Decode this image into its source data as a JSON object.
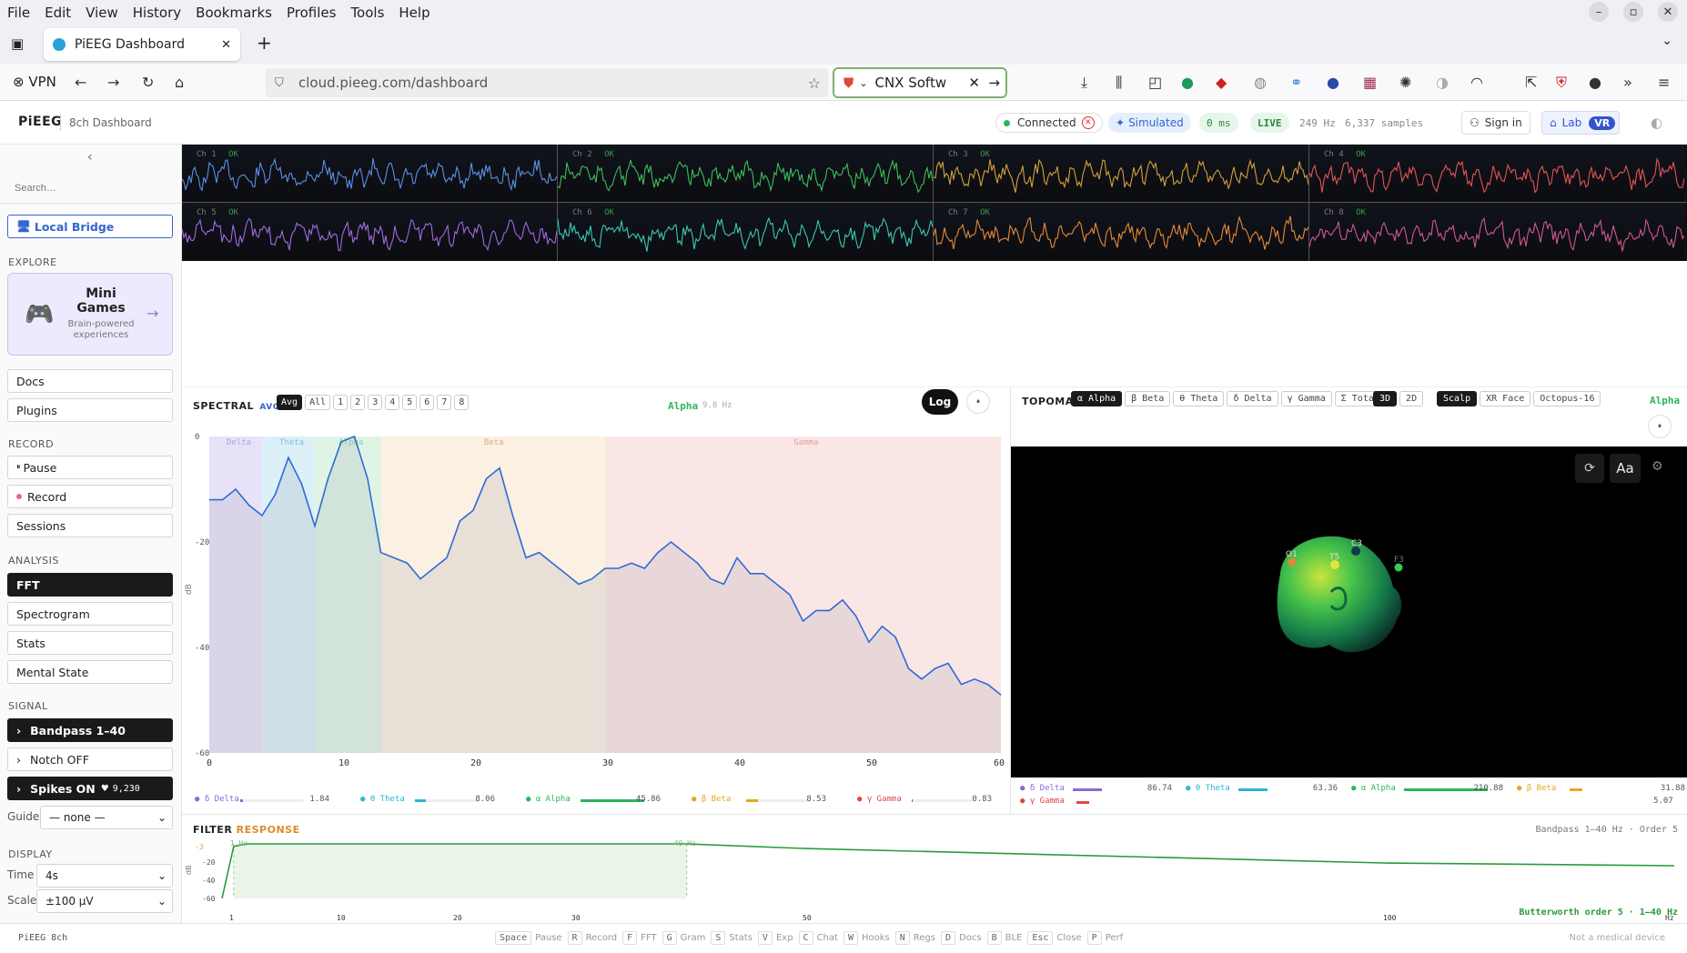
{
  "browser": {
    "menu": [
      "File",
      "Edit",
      "View",
      "History",
      "Bookmarks",
      "Profiles",
      "Tools",
      "Help"
    ],
    "tab_title": "PiEEG Dashboard",
    "vpn_label": "VPN",
    "url": "cloud.pieeg.com/dashboard",
    "search_text": "CNX Softw"
  },
  "app": {
    "brand": "PiEEG",
    "subtitle": "8ch Dashboard",
    "status": {
      "connected": "Connected",
      "simulated": "Simulated",
      "latency": "0 ms",
      "live": "LIVE",
      "rate": "249 Hz",
      "samples": "6,337 samples"
    },
    "signin": "Sign in",
    "lab": "Lab",
    "vr": "VR"
  },
  "sidebar": {
    "search_placeholder": "Search…",
    "local_bridge": "Local Bridge",
    "explore_label": "EXPLORE",
    "minigames_title": "Mini Games",
    "minigames_sub": "Brain-powered experiences",
    "docs": "Docs",
    "plugins": "Plugins",
    "record_label": "RECORD",
    "pause": "Pause",
    "record": "Record",
    "sessions": "Sessions",
    "analysis_label": "ANALYSIS",
    "fft": "FFT",
    "spectrogram": "Spectrogram",
    "stats": "Stats",
    "mental": "Mental State",
    "signal_label": "SIGNAL",
    "bandpass": "Bandpass 1–40",
    "notch": "Notch OFF",
    "spikes": "Spikes ON",
    "spikes_count": "9,230",
    "guide_label": "Guide",
    "guide_value": "— none —",
    "display_label": "DISPLAY",
    "time_label": "Time",
    "time_value": "4s",
    "scale_label": "Scale",
    "scale_value": "±100 µV"
  },
  "channels": [
    {
      "name": "Ch 1",
      "status": "OK",
      "color": "#5b8fe6"
    },
    {
      "name": "Ch 2",
      "status": "OK",
      "color": "#3dbd5c"
    },
    {
      "name": "Ch 3",
      "status": "OK",
      "color": "#d4a03a"
    },
    {
      "name": "Ch 4",
      "status": "OK",
      "color": "#e25555"
    },
    {
      "name": "Ch 5",
      "status": "OK",
      "color": "#a06ae0"
    },
    {
      "name": "Ch 6",
      "status": "OK",
      "color": "#3cc6b4"
    },
    {
      "name": "Ch 7",
      "status": "OK",
      "color": "#e58a3a"
    },
    {
      "name": "Ch 8",
      "status": "OK",
      "color": "#d05a8a"
    }
  ],
  "spectral": {
    "title": "SPECTRAL",
    "mode": "AVG",
    "chips": [
      "Avg",
      "All",
      "1",
      "2",
      "3",
      "4",
      "5",
      "6",
      "7",
      "8"
    ],
    "peak_band": "Alpha",
    "peak_freq": "9.8 Hz",
    "log": "Log",
    "ylabel": "dB",
    "xunit": "Hz",
    "band_labels": [
      "Delta",
      "Theta",
      "Alpha",
      "Beta",
      "Gamma"
    ],
    "legend": [
      {
        "label": "δ Delta",
        "value": "1.84",
        "color": "#8a6ad8"
      },
      {
        "label": "θ Theta",
        "value": "8.06",
        "color": "#2bb5d8"
      },
      {
        "label": "α Alpha",
        "value": "45.86",
        "color": "#2cb55c"
      },
      {
        "label": "β Beta",
        "value": "8.53",
        "color": "#e8a52a"
      },
      {
        "label": "γ Gamma",
        "value": "0.83",
        "color": "#e04848"
      }
    ]
  },
  "chart_data": [
    {
      "type": "line",
      "title": "",
      "xlabel": "Hz",
      "ylabel": "dB",
      "xlim": [
        0,
        60
      ],
      "ylim": [
        -60,
        0
      ],
      "xticks": [
        0,
        10,
        20,
        30,
        40,
        50,
        60
      ],
      "yticks": [
        0,
        -20,
        -40,
        -60
      ],
      "x": [
        0,
        1,
        2,
        3,
        4,
        5,
        6,
        7,
        8,
        9,
        10,
        11,
        12,
        13,
        14,
        15,
        16,
        17,
        18,
        19,
        20,
        21,
        22,
        23,
        24,
        25,
        26,
        27,
        28,
        29,
        30,
        31,
        32,
        33,
        34,
        35,
        36,
        37,
        38,
        39,
        40,
        41,
        42,
        43,
        44,
        45,
        46,
        47,
        48,
        49,
        50,
        51,
        52,
        53,
        54,
        55,
        56,
        57,
        58,
        59,
        60
      ],
      "y": [
        -12,
        -12,
        -10,
        -13,
        -15,
        -11,
        -4,
        -9,
        -17,
        -8,
        -1,
        0,
        -8,
        -22,
        -23,
        -24,
        -27,
        -25,
        -23,
        -16,
        -14,
        -8,
        -6,
        -15,
        -23,
        -22,
        -24,
        -26,
        -28,
        -27,
        -25,
        -25,
        -24,
        -25,
        -22,
        -20,
        -22,
        -24,
        -27,
        -28,
        -23,
        -26,
        -26,
        -28,
        -30,
        -35,
        -33,
        -33,
        -31,
        -34,
        -39,
        -36,
        -38,
        -44,
        -46,
        -44,
        -43,
        -47,
        -46,
        -47,
        -49
      ],
      "bands": [
        {
          "name": "Delta",
          "from": 0,
          "to": 4
        },
        {
          "name": "Theta",
          "from": 4,
          "to": 8
        },
        {
          "name": "Alpha",
          "from": 8,
          "to": 13
        },
        {
          "name": "Beta",
          "from": 13,
          "to": 30
        },
        {
          "name": "Gamma",
          "from": 30,
          "to": 60
        }
      ]
    },
    {
      "type": "line",
      "title": "FILTER RESPONSE",
      "ylabel": "dB",
      "xlim": [
        0,
        125
      ],
      "ylim": [
        -60,
        0
      ],
      "xticks": [
        1,
        10,
        20,
        30,
        50,
        100
      ],
      "yticks": [
        -3,
        -20,
        -40,
        -60
      ],
      "x": [
        0,
        1,
        2,
        5,
        10,
        20,
        30,
        40,
        50,
        100,
        125
      ],
      "y": [
        -60,
        -3,
        0,
        0,
        0,
        0,
        0,
        0,
        -5,
        -21,
        -24
      ],
      "markers": [
        "1 Hz",
        "40 Hz"
      ]
    }
  ],
  "filter": {
    "title": "FILTER",
    "title2": "RESPONSE",
    "info": "Bandpass 1–40 Hz · Order 5",
    "ylabel": "dB",
    "marker1": "1 Hz",
    "marker2": "40 Hz",
    "note": "Butterworth order 5 · 1–40 Hz",
    "m3db": "-3"
  },
  "topomap": {
    "title": "TOPOMAP",
    "chips": [
      "α Alpha",
      "β Beta",
      "θ Theta",
      "δ Delta",
      "γ Gamma",
      "Σ Total"
    ],
    "view": [
      "3D",
      "2D"
    ],
    "scalp": "Scalp",
    "xr": "XR Face",
    "octopus": "Octopus-16",
    "current": "Alpha",
    "aa": "Aa",
    "electrodes": [
      "O1",
      "T5",
      "C3",
      "F3"
    ],
    "legend": [
      {
        "label": "δ Delta",
        "value": "86.74",
        "color": "#8a6ad8"
      },
      {
        "label": "θ Theta",
        "value": "63.36",
        "color": "#2bb5d8"
      },
      {
        "label": "α Alpha",
        "value": "210.88",
        "color": "#2cb55c"
      },
      {
        "label": "β Beta",
        "value": "31.88",
        "color": "#e8a52a"
      },
      {
        "label": "γ Gamma",
        "value": "5.07",
        "color": "#e04848"
      }
    ]
  },
  "footer": {
    "brand": "PiEEG 8ch",
    "shortcuts": [
      [
        "Space",
        "Pause"
      ],
      [
        "R",
        "Record"
      ],
      [
        "F",
        "FFT"
      ],
      [
        "G",
        "Gram"
      ],
      [
        "S",
        "Stats"
      ],
      [
        "V",
        "Exp"
      ],
      [
        "C",
        "Chat"
      ],
      [
        "W",
        "Hooks"
      ],
      [
        "N",
        "Regs"
      ],
      [
        "D",
        "Docs"
      ],
      [
        "B",
        "BLE"
      ],
      [
        "Esc",
        "Close"
      ],
      [
        "P",
        "Perf"
      ]
    ],
    "disclaimer": "Not a medical device"
  }
}
